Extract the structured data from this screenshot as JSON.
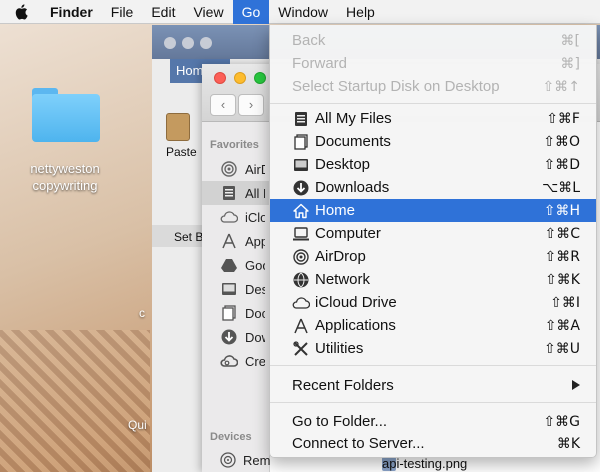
{
  "menubar": {
    "app": "Finder",
    "items": [
      "File",
      "Edit",
      "View",
      "Go",
      "Window",
      "Help"
    ],
    "active": "Go"
  },
  "desktop": {
    "folder_label_line1": "nettyweston",
    "folder_label_line2": "copywriting",
    "partial_qui": "Qui",
    "partial_c": "c"
  },
  "back_window": {
    "tab_label": "Home",
    "paste_label": "Paste",
    "set_label": "Set B"
  },
  "front_window": {
    "sidebar": {
      "favorites_heading": "Favorites",
      "favorites": [
        {
          "label": "AirDrop",
          "icon": "airdrop-icon"
        },
        {
          "label": "All My Files",
          "icon": "all-my-files-icon"
        },
        {
          "label": "iCloud Drive",
          "icon": "icloud-icon"
        },
        {
          "label": "Applications",
          "icon": "applications-icon"
        },
        {
          "label": "Google Drive",
          "icon": "google-drive-icon"
        },
        {
          "label": "Desktop",
          "icon": "desktop-icon"
        },
        {
          "label": "Documents",
          "icon": "documents-icon"
        },
        {
          "label": "Downloads",
          "icon": "downloads-icon"
        },
        {
          "label": "Creative Cloud Files",
          "icon": "creative-cloud-icon"
        }
      ],
      "devices_heading": "Devices",
      "devices": [
        {
          "label": "Remote Disc",
          "icon": "remote-disc-icon"
        }
      ]
    },
    "file_label": "api-testing.png"
  },
  "go_menu": {
    "items": [
      {
        "label": "Back",
        "shortcut": "⌘[",
        "disabled": true
      },
      {
        "label": "Forward",
        "shortcut": "⌘]",
        "disabled": true
      },
      {
        "label": "Select Startup Disk on Desktop",
        "shortcut": "⇧⌘↑",
        "disabled": true
      },
      {
        "label": "All My Files",
        "shortcut": "⇧⌘F",
        "icon": "all-my-files-icon"
      },
      {
        "label": "Documents",
        "shortcut": "⇧⌘O",
        "icon": "documents-icon"
      },
      {
        "label": "Desktop",
        "shortcut": "⇧⌘D",
        "icon": "desktop-icon"
      },
      {
        "label": "Downloads",
        "shortcut": "⌥⌘L",
        "icon": "downloads-icon"
      },
      {
        "label": "Home",
        "shortcut": "⇧⌘H",
        "icon": "home-icon",
        "highlighted": true
      },
      {
        "label": "Computer",
        "shortcut": "⇧⌘C",
        "icon": "computer-icon"
      },
      {
        "label": "AirDrop",
        "shortcut": "⇧⌘R",
        "icon": "airdrop-icon"
      },
      {
        "label": "Network",
        "shortcut": "⇧⌘K",
        "icon": "network-icon"
      },
      {
        "label": "iCloud Drive",
        "shortcut": "⇧⌘I",
        "icon": "icloud-icon"
      },
      {
        "label": "Applications",
        "shortcut": "⇧⌘A",
        "icon": "applications-icon"
      },
      {
        "label": "Utilities",
        "shortcut": "⇧⌘U",
        "icon": "utilities-icon"
      },
      {
        "label": "Recent Folders",
        "submenu": true
      },
      {
        "label": "Go to Folder...",
        "shortcut": "⇧⌘G"
      },
      {
        "label": "Connect to Server...",
        "shortcut": "⌘K"
      }
    ]
  },
  "colors": {
    "accent": "#2f72d8",
    "folder_blue": "#5cb7f0"
  }
}
